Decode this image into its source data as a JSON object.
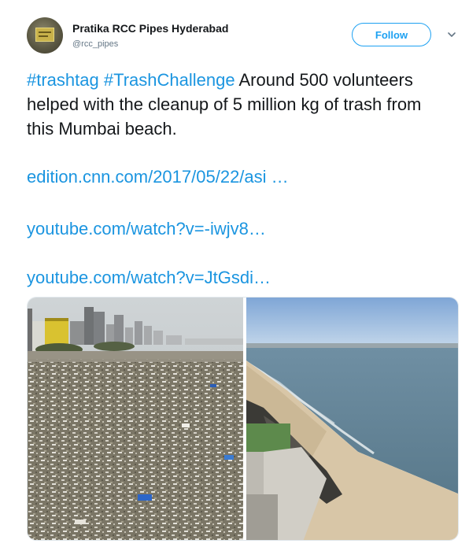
{
  "user": {
    "display_name": "Pratika RCC Pipes Hyderabad",
    "handle": "@rcc_pipes"
  },
  "actions": {
    "follow_label": "Follow",
    "more_icon": "chevron-down-icon"
  },
  "tweet": {
    "hashtag_1": "#trashtag",
    "hashtag_2": "#TrashChallenge",
    "text": " Around 500 volunteers helped with the cleanup of 5 million kg of trash from this Mumbai beach.",
    "links": [
      "edition.cnn.com/2017/05/22/asi …",
      "youtube.com/watch?v=-iwjv8…",
      "youtube.com/watch?v=JtGsdi…"
    ]
  },
  "colors": {
    "accent": "#1da1f2",
    "link": "#1b95e0",
    "text": "#14171a",
    "muted": "#657786"
  },
  "media": {
    "count": 2,
    "images": [
      "beach-trash-photo",
      "clean-beach-photo"
    ]
  }
}
